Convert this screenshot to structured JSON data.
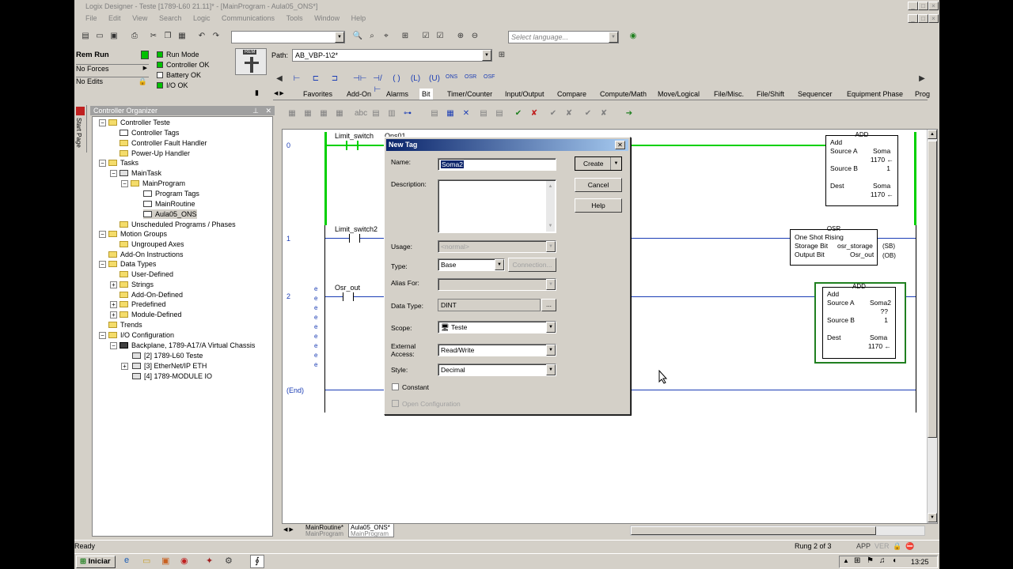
{
  "window": {
    "title": "Logix Designer - Teste [1789-L60 21.11]* - [MainProgram - Aula05_ONS*]",
    "menu": [
      "File",
      "Edit",
      "View",
      "Search",
      "Logic",
      "Communications",
      "Tools",
      "Window",
      "Help"
    ]
  },
  "toolbar": {
    "language_placeholder": "Select language...",
    "path_label": "Path:",
    "path_value": "AB_VBP-1\\2*"
  },
  "controller_status": {
    "mode": "Rem Run",
    "forces": "No Forces",
    "edits": "No Edits",
    "indicators": [
      {
        "label": "Run Mode",
        "color": "#00c000"
      },
      {
        "label": "Controller OK",
        "color": "#00c000"
      },
      {
        "label": "Battery OK",
        "color": "#ffffff"
      },
      {
        "label": "I/O OK",
        "color": "#00c000"
      }
    ],
    "keyswitch_label": "REM"
  },
  "instruction_buttons": [
    "ONS",
    "OSR",
    "OSF"
  ],
  "instruction_tabs": [
    "Favorites",
    "Add-On",
    "Alarms",
    "Bit",
    "Timer/Counter",
    "Input/Output",
    "Compare",
    "Compute/Math",
    "Move/Logical",
    "File/Misc.",
    "File/Shift",
    "Sequencer",
    "Equipment Phase",
    "Prog"
  ],
  "organizer": {
    "title": "Controller Organizer",
    "start_page": "Start Page",
    "items": [
      "Controller Teste",
      "Controller Tags",
      "Controller Fault Handler",
      "Power-Up Handler",
      "Tasks",
      "MainTask",
      "MainProgram",
      "Program Tags",
      "MainRoutine",
      "Aula05_ONS",
      "Unscheduled Programs / Phases",
      "Motion Groups",
      "Ungrouped Axes",
      "Add-On Instructions",
      "Data Types",
      "User-Defined",
      "Strings",
      "Add-On-Defined",
      "Predefined",
      "Module-Defined",
      "Trends",
      "I/O Configuration",
      "Backplane, 1789-A17/A Virtual Chassis",
      "[2] 1789-L60 Teste",
      "[3] EtherNet/IP ETH",
      "[4] 1789-MODULE IO"
    ]
  },
  "ladder": {
    "rungs": [
      {
        "number": "0",
        "contact_tag": "Limit_switch",
        "ons_tag": "Ons01",
        "instruction": {
          "type": "ADD",
          "name": "Add",
          "source_a_label": "Source A",
          "source_a": "Soma",
          "source_a_val": "1170 ←",
          "source_b_label": "Source B",
          "source_b": "1",
          "dest_label": "Dest",
          "dest": "Soma",
          "dest_val": "1170 ←"
        }
      },
      {
        "number": "1",
        "contact_tag": "Limit_switch2",
        "instruction": {
          "type": "OSR",
          "name": "One Shot Rising",
          "storage_label": "Storage Bit",
          "storage": "osr_storage",
          "output_label": "Output Bit",
          "output": "Osr_out",
          "pin1": "(SB)",
          "pin2": "(OB)"
        }
      },
      {
        "number": "2",
        "contact_tag": "Osr_out",
        "instruction": {
          "type": "ADD",
          "name": "Add",
          "source_a_label": "Source A",
          "source_a": "Soma2",
          "source_a_val": "??",
          "source_b_label": "Source B",
          "source_b": "1",
          "dest_label": "Dest",
          "dest": "Soma",
          "dest_val": "1170 ←"
        }
      }
    ],
    "end_label": "(End)"
  },
  "routine_tabs": [
    {
      "name": "MainRoutine*",
      "sub": "MainProgram"
    },
    {
      "name": "Aula05_ONS*",
      "sub": "MainProgram"
    }
  ],
  "dialog": {
    "title": "New Tag",
    "name_label": "Name:",
    "name_value": "Soma2",
    "description_label": "Description:",
    "usage_label": "Usage:",
    "usage_value": "<normal>",
    "type_label": "Type:",
    "type_value": "Base",
    "connection_label": "Connection...",
    "alias_label": "Alias For:",
    "datatype_label": "Data Type:",
    "datatype_value": "DINT",
    "scope_label": "Scope:",
    "scope_value": "Teste",
    "external_label_1": "External",
    "external_label_2": "Access:",
    "external_value": "Read/Write",
    "style_label": "Style:",
    "style_value": "Decimal",
    "constant_label": "Constant",
    "open_config_label": "Open Configuration",
    "create_label": "Create",
    "cancel_label": "Cancel",
    "help_label": "Help"
  },
  "statusbar": {
    "left": "Ready",
    "rung": "Rung 2 of 3",
    "app": "APP",
    "ver": "VER"
  },
  "taskbar": {
    "start": "Iniciar",
    "clock": "13:25"
  }
}
